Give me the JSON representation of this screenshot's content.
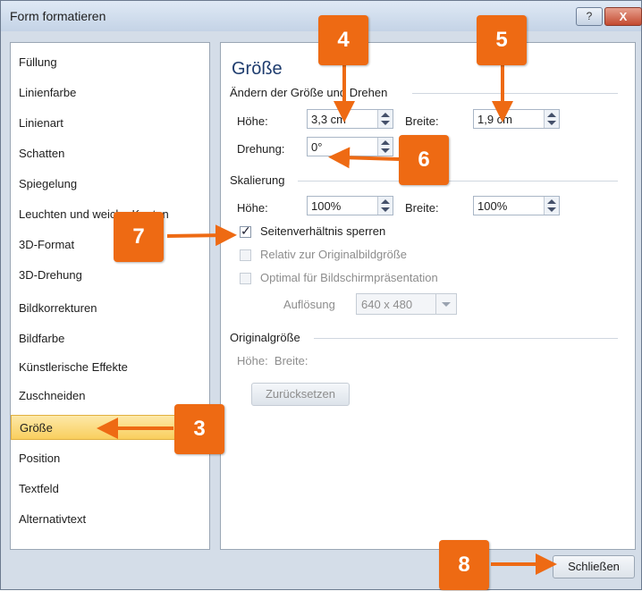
{
  "window": {
    "title": "Form formatieren",
    "help_label": "?",
    "close_label": "X"
  },
  "nav": {
    "items": [
      {
        "label": "Füllung"
      },
      {
        "label": "Linienfarbe"
      },
      {
        "label": "Linienart"
      },
      {
        "label": "Schatten"
      },
      {
        "label": "Spiegelung"
      },
      {
        "label": "Leuchten und weiche Kanten"
      },
      {
        "label": "3D-Format"
      },
      {
        "label": "3D-Drehung"
      },
      {
        "label": "Bildkorrekturen"
      },
      {
        "label": "Bildfarbe"
      },
      {
        "label": "Künstlerische Effekte"
      },
      {
        "label": "Zuschneiden"
      },
      {
        "label": "Größe"
      },
      {
        "label": "Position"
      },
      {
        "label": "Textfeld"
      },
      {
        "label": "Alternativtext"
      }
    ],
    "selected": "Größe"
  },
  "main": {
    "heading": "Größe",
    "size_rotate": {
      "section_label": "Ändern der Größe und Drehen",
      "height_label": "Höhe:",
      "height_value": "3,3 cm",
      "width_label": "Breite:",
      "width_value": "1,9 cm",
      "rotation_label": "Drehung:",
      "rotation_value": "0°"
    },
    "scale": {
      "section_label": "Skalierung",
      "height_label": "Höhe:",
      "height_value": "100%",
      "width_label": "Breite:",
      "width_value": "100%",
      "lock_aspect_label": "Seitenverhältnis sperren",
      "lock_aspect_checked": true,
      "relative_label": "Relativ zur Originalbildgröße",
      "optimal_label": "Optimal für Bildschirmpräsentation",
      "resolution_label": "Auflösung",
      "resolution_value": "640 x 480"
    },
    "original": {
      "section_label": "Originalgröße",
      "dims_label": "Höhe:  Breite:",
      "reset_label": "Zurücksetzen"
    }
  },
  "footer": {
    "close_button": "Schließen"
  },
  "callouts": [
    "3",
    "4",
    "5",
    "6",
    "7",
    "8"
  ],
  "colors": {
    "callout": "#ee6a13",
    "selection": "#f9cf5e",
    "heading": "#1e3c6e"
  }
}
